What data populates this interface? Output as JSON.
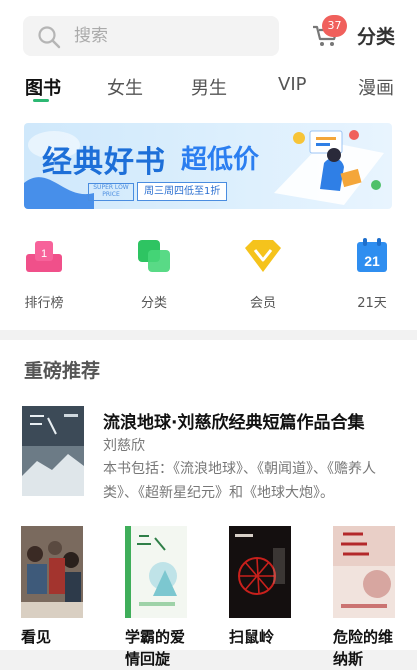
{
  "search": {
    "placeholder": "搜索"
  },
  "cart": {
    "badge": "37"
  },
  "header": {
    "category_link": "分类"
  },
  "tabs": [
    {
      "label": "图书",
      "active": true
    },
    {
      "label": "女生"
    },
    {
      "label": "男生"
    },
    {
      "label": "VIP"
    },
    {
      "label": "漫画"
    }
  ],
  "banner": {
    "title_main": "经典好书",
    "title_accent": "超低价",
    "super_low_price": "SUPER LOW PRICE",
    "tag": "周三周四低至1折"
  },
  "quick_links": [
    {
      "label": "排行榜",
      "icon": "ranking-podium-icon",
      "color": "#f0508a"
    },
    {
      "label": "分类",
      "icon": "category-squares-icon",
      "color": "#2ec462"
    },
    {
      "label": "会员",
      "icon": "vip-diamond-icon",
      "color": "#f5c31c"
    },
    {
      "label": "21天",
      "icon": "calendar-21-icon",
      "color": "#2f8ef0",
      "icon_text": "21"
    }
  ],
  "recommend": {
    "title": "重磅推荐",
    "featured": {
      "title": "流浪地球·刘慈欣经典短篇作品合集",
      "author": "刘慈欣",
      "description": "本书包括：《流浪地球》、《朝闻道》、《赡养人类》、《超新星纪元》和《地球大炮》。"
    },
    "books": [
      {
        "title": "看见"
      },
      {
        "title": "学霸的爱情回旋"
      },
      {
        "title": "扫鼠岭"
      },
      {
        "title": "危险的维纳斯"
      }
    ]
  },
  "colors": {
    "accent": "#2db873",
    "badge": "#f0605c"
  }
}
